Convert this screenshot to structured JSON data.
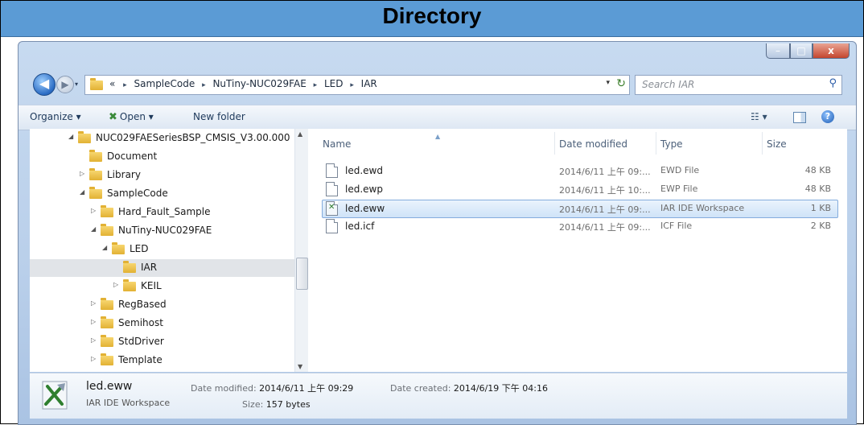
{
  "page_title": "Directory",
  "window": {
    "controls": {
      "minimize": "–",
      "maximize": "□",
      "close": "x"
    }
  },
  "nav": {
    "back_icon": "back-arrow-icon",
    "forward_icon": "forward-arrow-icon",
    "recent_glyph": "▾"
  },
  "address": {
    "prefix": "«",
    "crumbs": [
      "SampleCode",
      "NuTiny-NUC029FAE",
      "LED",
      "IAR"
    ],
    "separator": "▸",
    "dropdown_glyph": "▾",
    "refresh_glyph": "↻"
  },
  "search": {
    "placeholder": "Search IAR",
    "icon": "search-icon"
  },
  "toolbar": {
    "organize_label": "Organize ▾",
    "open_label": "Open ▾",
    "new_folder_label": "New folder",
    "views_label": "☷ ▾",
    "help_label": "?"
  },
  "tree": [
    {
      "label": "NUC029FAESeriesBSP_CMSIS_V3.00.000",
      "arrow": "◢",
      "level": 0
    },
    {
      "label": "Document",
      "arrow": "",
      "level": 1
    },
    {
      "label": "Library",
      "arrow": "▷",
      "level": 1
    },
    {
      "label": "SampleCode",
      "arrow": "◢",
      "level": 1
    },
    {
      "label": "Hard_Fault_Sample",
      "arrow": "▷",
      "level": 2
    },
    {
      "label": "NuTiny-NUC029FAE",
      "arrow": "◢",
      "level": 2
    },
    {
      "label": "LED",
      "arrow": "◢",
      "level": 3
    },
    {
      "label": "IAR",
      "arrow": "",
      "level": 4,
      "selected": true
    },
    {
      "label": "KEIL",
      "arrow": "▷",
      "level": 4
    },
    {
      "label": "RegBased",
      "arrow": "▷",
      "level": 2
    },
    {
      "label": "Semihost",
      "arrow": "▷",
      "level": 2
    },
    {
      "label": "StdDriver",
      "arrow": "▷",
      "level": 2
    },
    {
      "label": "Template",
      "arrow": "▷",
      "level": 2
    }
  ],
  "columns": {
    "name": "Name",
    "date": "Date modified",
    "type": "Type",
    "size": "Size"
  },
  "files": [
    {
      "name": "led.ewd",
      "date": "2014/6/11 上午 09:...",
      "type": "EWD File",
      "size": "48 KB"
    },
    {
      "name": "led.ewp",
      "date": "2014/6/11 上午 10:...",
      "type": "EWP File",
      "size": "48 KB"
    },
    {
      "name": "led.eww",
      "date": "2014/6/11 上午 09:...",
      "type": "IAR IDE Workspace",
      "size": "1 KB",
      "selected": true
    },
    {
      "name": "led.icf",
      "date": "2014/6/11 上午 09:...",
      "type": "ICF File",
      "size": "2 KB"
    }
  ],
  "details": {
    "name": "led.eww",
    "type": "IAR IDE Workspace",
    "modified_label": "Date modified:",
    "modified_value": "2014/6/11 上午 09:29",
    "size_label": "Size:",
    "size_value": "157 bytes",
    "created_label": "Date created:",
    "created_value": "2014/6/19 下午 04:16"
  }
}
